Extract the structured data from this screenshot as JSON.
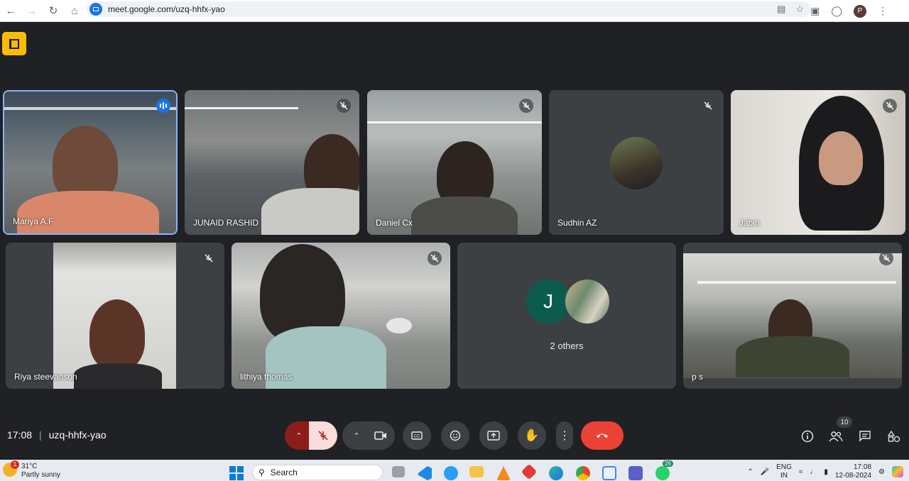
{
  "browser": {
    "url": "meet.google.com/uzq-hhfx-yao",
    "profile_initial": "P"
  },
  "participants": [
    {
      "name": "Mariya A.F",
      "state": "speaking"
    },
    {
      "name": "JUNAID RASHID",
      "state": "muted"
    },
    {
      "name": "Daniel Cx",
      "state": "muted"
    },
    {
      "name": "Sudhin AZ",
      "state": "muted"
    },
    {
      "name": "Jabin",
      "state": "muted"
    },
    {
      "name": "Riya steevanson",
      "state": "muted"
    },
    {
      "name": "lithiya thomas",
      "state": "muted"
    },
    {
      "name": "2 others",
      "avatar_initial": "J"
    },
    {
      "name": "p s",
      "state": "muted"
    }
  ],
  "meeting": {
    "time": "17:08",
    "code": "uzq-hhfx-yao",
    "people_count": "10"
  },
  "colors": {
    "background": "#202124",
    "tile": "#3c4043",
    "mic_off_active": "#f9dedc",
    "leave_call": "#ea4335",
    "active_border": "#8ab4f8",
    "logo": "#fbbc04"
  },
  "taskbar": {
    "weather_temp": "31°C",
    "weather_desc": "Partly sunny",
    "weather_badge": "1",
    "search_placeholder": "Search",
    "whatsapp_badge": "26",
    "lang_line1": "ENG",
    "lang_line2": "IN",
    "clock_time": "17:08",
    "clock_date": "12-08-2024"
  }
}
